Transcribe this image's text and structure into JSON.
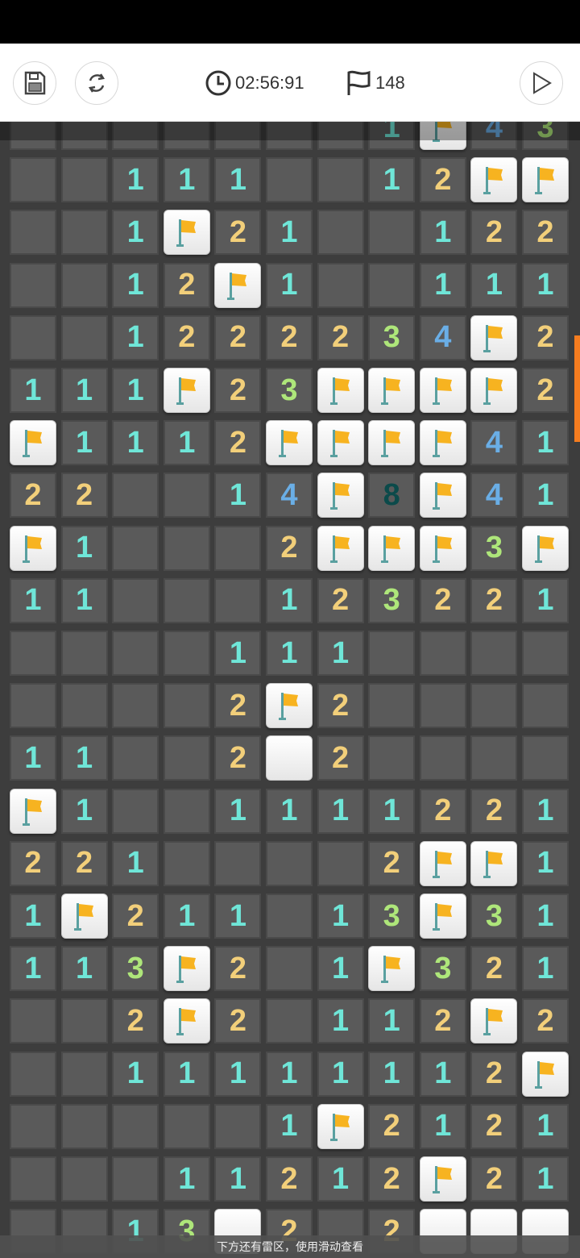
{
  "toolbar": {
    "timer": "02:56:91",
    "flag_count": "148"
  },
  "board": {
    "columns": 11,
    "rows": [
      [
        "",
        "",
        "",
        "",
        "",
        "",
        "",
        "1",
        "F",
        "4",
        "3"
      ],
      [
        "",
        "",
        "1",
        "1",
        "1",
        "",
        "",
        "1",
        "2",
        "F",
        "F"
      ],
      [
        "",
        "",
        "1",
        "F",
        "2",
        "1",
        "",
        "",
        "1",
        "2",
        "2"
      ],
      [
        "",
        "",
        "1",
        "2",
        "F",
        "1",
        "",
        "",
        "1",
        "1",
        "1"
      ],
      [
        "",
        "",
        "1",
        "2",
        "2",
        "2",
        "2",
        "3",
        "4",
        "F",
        "2"
      ],
      [
        "1",
        "1",
        "1",
        "F",
        "2",
        "3",
        "F",
        "F",
        "F",
        "F",
        "2"
      ],
      [
        "F",
        "1",
        "1",
        "1",
        "2",
        "F",
        "F",
        "F",
        "F",
        "4",
        "1"
      ],
      [
        "2",
        "2",
        "",
        "",
        "1",
        "4",
        "F",
        "8",
        "F",
        "4",
        "1"
      ],
      [
        "F",
        "1",
        "",
        "",
        "",
        "2",
        "F",
        "F",
        "F",
        "3",
        "F"
      ],
      [
        "1",
        "1",
        "",
        "",
        "",
        "1",
        "2",
        "3",
        "2",
        "2",
        "1"
      ],
      [
        "",
        "",
        "",
        "",
        "1",
        "1",
        "1",
        "",
        "",
        "",
        ""
      ],
      [
        "",
        "",
        "",
        "",
        "2",
        "F",
        "2",
        "",
        "",
        "",
        ""
      ],
      [
        "1",
        "1",
        "",
        "",
        "2",
        "O",
        "2",
        "",
        "",
        "",
        ""
      ],
      [
        "F",
        "1",
        "",
        "",
        "1",
        "1",
        "1",
        "1",
        "2",
        "2",
        "1"
      ],
      [
        "2",
        "2",
        "1",
        "",
        "",
        "",
        "",
        "2",
        "F",
        "F",
        "1"
      ],
      [
        "1",
        "F",
        "2",
        "1",
        "1",
        "",
        "1",
        "3",
        "F",
        "3",
        "1"
      ],
      [
        "1",
        "1",
        "3",
        "F",
        "2",
        "",
        "1",
        "F",
        "3",
        "2",
        "1"
      ],
      [
        "",
        "",
        "2",
        "F",
        "2",
        "",
        "1",
        "1",
        "2",
        "F",
        "2"
      ],
      [
        "",
        "",
        "1",
        "1",
        "1",
        "1",
        "1",
        "1",
        "1",
        "2",
        "F"
      ],
      [
        "",
        "",
        "",
        "",
        "",
        "1",
        "F",
        "2",
        "1",
        "2",
        "1"
      ],
      [
        "",
        "",
        "",
        "1",
        "1",
        "2",
        "1",
        "2",
        "F",
        "2",
        "1"
      ],
      [
        "",
        "",
        "1",
        "3",
        "O",
        "2",
        "",
        "2",
        "O",
        "O",
        "O"
      ]
    ]
  },
  "hint": "下方还有雷区，使用滑动查看"
}
